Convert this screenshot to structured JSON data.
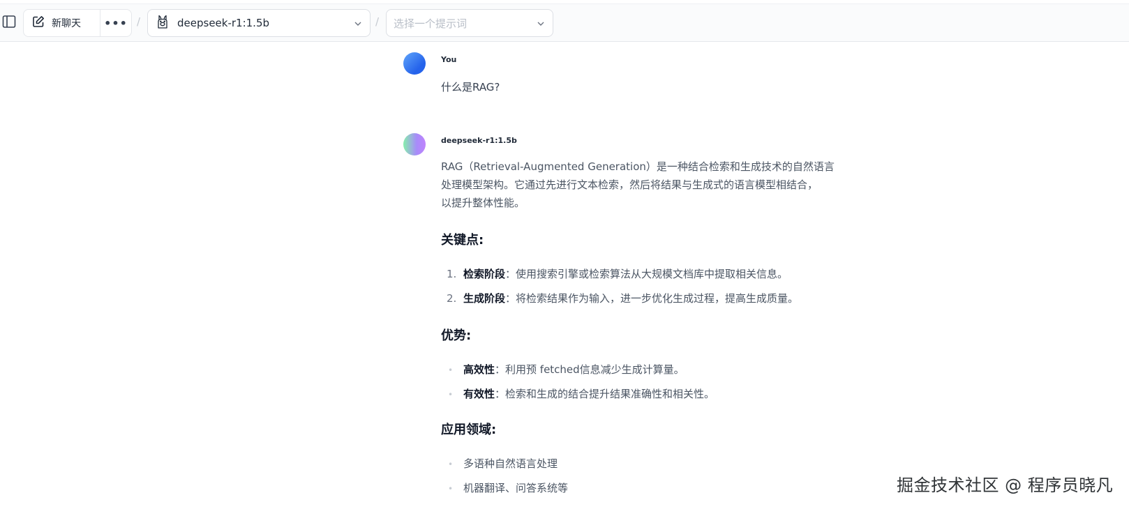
{
  "toolbar": {
    "new_chat_label": "新聊天",
    "more_label": "•••",
    "separator": "/",
    "model_label": "deepseek-r1:1.5b",
    "prompt_placeholder": "选择一个提示词"
  },
  "conversation": {
    "user": {
      "name": "You",
      "message": "什么是RAG?"
    },
    "assistant": {
      "name": "deepseek-r1:1.5b",
      "intro_lines": [
        "RAG（Retrieval-Augmented Generation）是一种结合检索和生成技术的自然语言",
        "处理模型架构。它通过先进行文本检索，然后将结果与生成式的语言模型相结合，",
        "以提升整体性能。"
      ],
      "key_points": {
        "heading": "关键点:",
        "items": [
          {
            "marker": "1.",
            "term": "检索阶段",
            "text": "：使用搜索引擎或检索算法从大规模文档库中提取相关信息。"
          },
          {
            "marker": "2.",
            "term": "生成阶段",
            "text": "：将检索结果作为输入，进一步优化生成过程，提高生成质量。"
          }
        ]
      },
      "advantages": {
        "heading": "优势:",
        "items": [
          {
            "marker": "•",
            "term": "高效性",
            "text": "：利用预 fetched信息减少生成计算量。"
          },
          {
            "marker": "•",
            "term": "有效性",
            "text": "：检索和生成的结合提升结果准确性和相关性。"
          }
        ]
      },
      "applications": {
        "heading": "应用领域:",
        "items": [
          {
            "marker": "•",
            "text": "多语种自然语言处理"
          },
          {
            "marker": "•",
            "text": "机器翻译、问答系统等"
          }
        ]
      }
    }
  },
  "watermark": "掘金技术社区 @ 程序员晓凡",
  "colors": {
    "toolbar_bg": "#fafbfc",
    "border": "#e5e7eb",
    "text": "#4b5563",
    "heading": "#111827"
  }
}
